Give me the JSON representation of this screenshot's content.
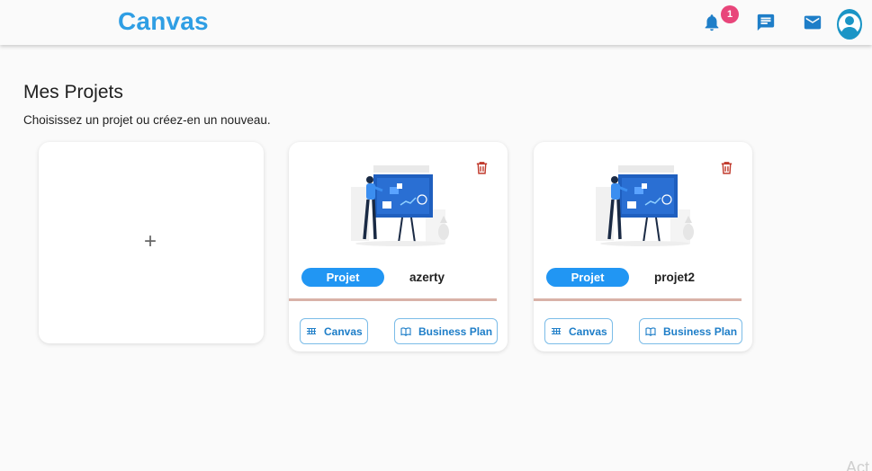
{
  "header": {
    "brand": "Canvas",
    "notification_count": "1",
    "icons": [
      "bell-icon",
      "chat-icon",
      "mail-icon",
      "user-avatar-icon"
    ]
  },
  "page": {
    "title": "Mes Projets",
    "subtitle": "Choisissez un projet ou créez-en un nouveau."
  },
  "add_card": {
    "label": "+"
  },
  "projects": [
    {
      "tag": "Projet",
      "name": "azerty",
      "canvas_label": "Canvas",
      "bp_label": "Business Plan"
    },
    {
      "tag": "Projet",
      "name": "projet2",
      "canvas_label": "Canvas",
      "bp_label": "Business Plan"
    }
  ],
  "footer": {
    "corner_text": "Act"
  },
  "colors": {
    "brand": "#2f9ee4",
    "pill": "#2196f3",
    "badge": "#e8457a",
    "trash": "#c0392b",
    "divider": "#d9b2a8",
    "button_border": "#7bbce8"
  }
}
